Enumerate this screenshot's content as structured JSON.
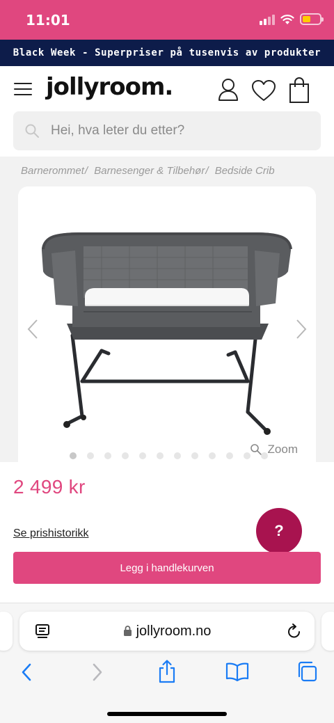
{
  "status_bar": {
    "time": "11:01"
  },
  "promo": {
    "text": "Black Week - Superpriser på tusenvis av produkter"
  },
  "header": {
    "logo": "jollyroom.",
    "search_placeholder": "Hei, hva leter du etter?"
  },
  "breadcrumb": {
    "items": [
      "Barnerommet",
      "Barnesenger & Tilbehør",
      "Bedside Crib"
    ],
    "separator": "/"
  },
  "product": {
    "zoom_label": "Zoom",
    "image_count": 12,
    "active_image_index": 0,
    "price": "2 499 kr",
    "price_history_link": "Se prishistorikk",
    "add_to_cart_label": "Legg i handlekurven",
    "help_label": "?"
  },
  "browser": {
    "url": "jollyroom.no"
  },
  "colors": {
    "brand_pink": "#e0477f",
    "promo_navy": "#0d1c4a",
    "help_magenta": "#a8134f",
    "ios_blue": "#1a7cf5"
  },
  "icons": [
    "menu-icon",
    "user-icon",
    "heart-icon",
    "shopping-bag-icon",
    "search-icon",
    "chevron-left-icon",
    "chevron-right-icon",
    "zoom-icon",
    "reader-icon",
    "lock-icon",
    "reload-icon",
    "back-icon",
    "forward-icon",
    "share-icon",
    "bookmarks-icon",
    "tabs-icon"
  ]
}
